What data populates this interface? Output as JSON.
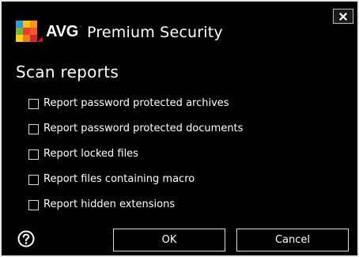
{
  "window": {
    "brand": "AVG",
    "brand_mark": ".",
    "product": "Premium Security",
    "close_icon": "close-icon",
    "logo_icon": "avg-logo-icon"
  },
  "section": {
    "title": "Scan reports"
  },
  "options": [
    {
      "label": "Report password protected archives",
      "checked": false
    },
    {
      "label": "Report password protected documents",
      "checked": false
    },
    {
      "label": "Report locked files",
      "checked": false
    },
    {
      "label": "Report files containing macro",
      "checked": false
    },
    {
      "label": "Report hidden extensions",
      "checked": false
    }
  ],
  "footer": {
    "help_icon": "help-icon",
    "ok_label": "OK",
    "cancel_label": "Cancel"
  },
  "colors": {
    "background": "#000000",
    "text": "#ffffff",
    "border": "#d9d9d9"
  }
}
